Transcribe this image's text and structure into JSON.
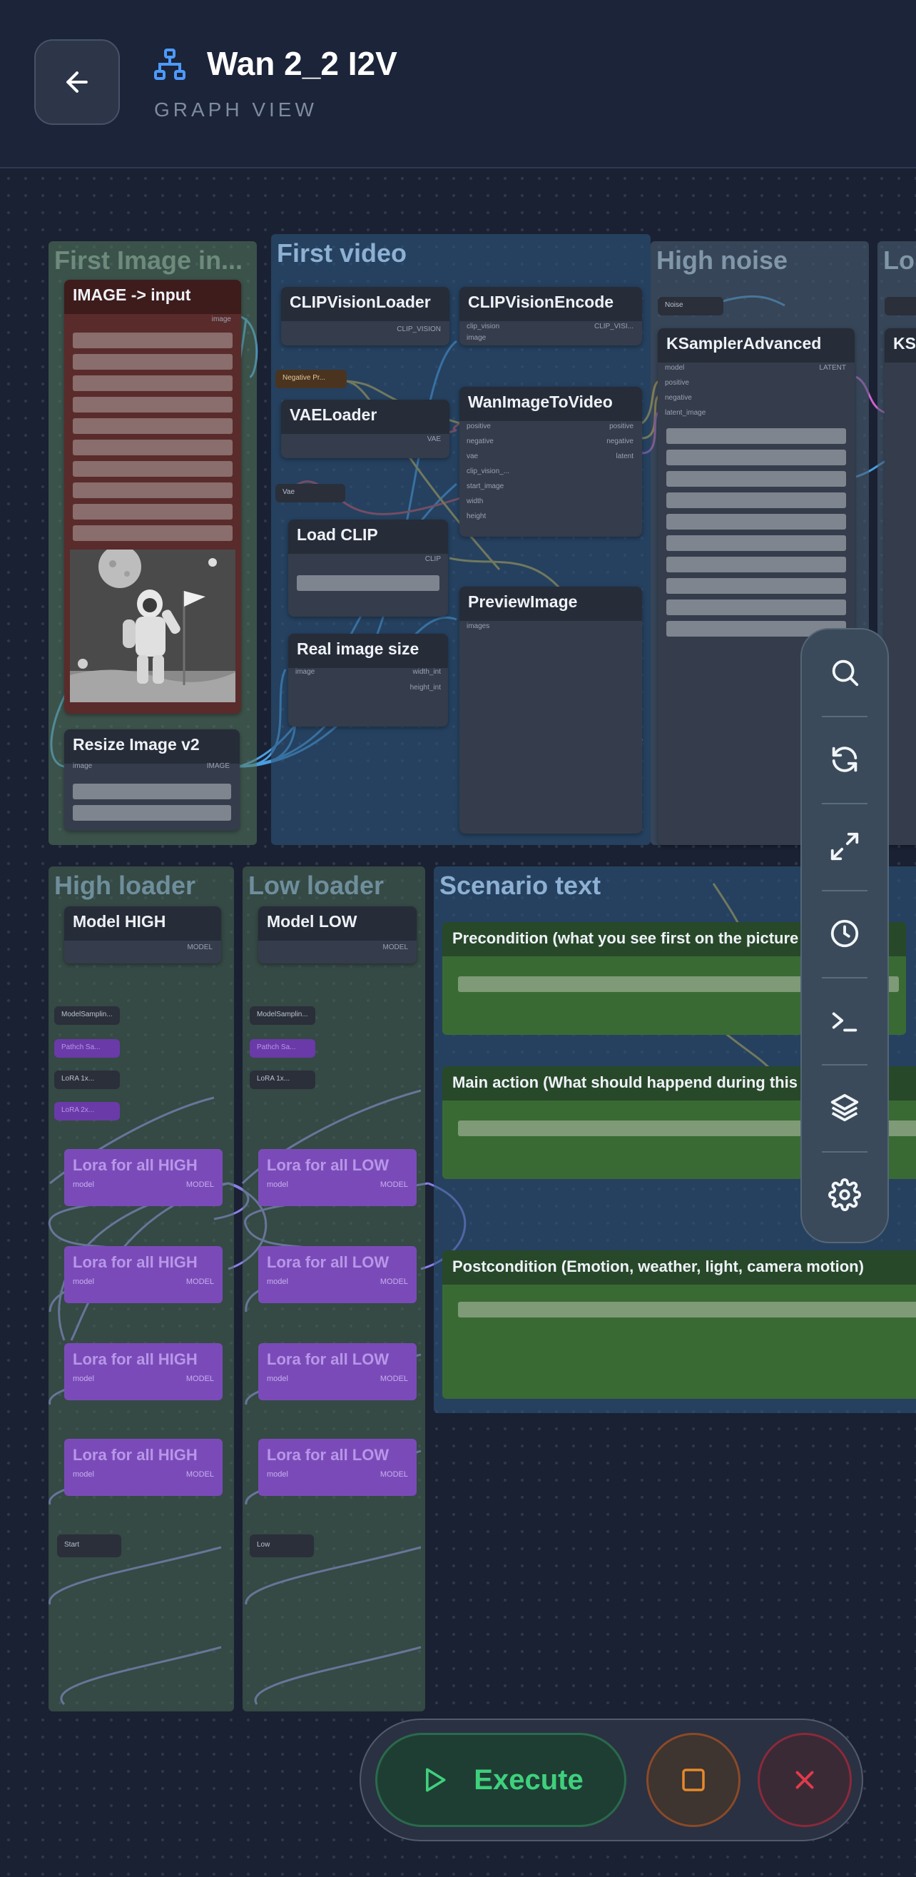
{
  "header": {
    "title": "Wan 2_2 I2V",
    "subtitle": "GRAPH VIEW",
    "back_icon": "arrow-left-icon",
    "title_icon": "graph-hierarchy-icon"
  },
  "graph": {
    "groups": {
      "first_image": "First Image in...",
      "first_video": "First video",
      "high_noise": "High noise",
      "low": "Lo",
      "high_loader": "High loader",
      "low_loader": "Low loader",
      "scenario_text": "Scenario text"
    },
    "nodes": {
      "image_input": {
        "title": "IMAGE -> input",
        "out": "image"
      },
      "resize_image": {
        "title": "Resize Image v2",
        "in": "image",
        "out": "IMAGE"
      },
      "clip_vision_loader": {
        "title": "CLIPVisionLoader",
        "out": "CLIP_VISION"
      },
      "clip_vision_encode": {
        "title": "CLIPVisionEncode",
        "in1": "clip_vision",
        "in2": "image",
        "out": "CLIP_VISI..."
      },
      "vae_loader": {
        "title": "VAELoader",
        "out": "VAE"
      },
      "wan_image_to_video": {
        "title": "WanImageToVideo",
        "inputs": [
          "positive",
          "negative",
          "vae",
          "clip_vision_...",
          "start_image",
          "width",
          "height"
        ],
        "outputs": [
          "positive",
          "negative",
          "latent"
        ]
      },
      "load_clip": {
        "title": "Load CLIP",
        "out": "CLIP"
      },
      "real_image_size": {
        "title": "Real image size",
        "in": "image",
        "out1": "width_int",
        "out2": "height_int"
      },
      "preview_image": {
        "title": "PreviewImage",
        "in": "images"
      },
      "ksampler_advanced": {
        "title": "KSamplerAdvanced",
        "inputs": [
          "model",
          "positive",
          "negative",
          "latent_image"
        ],
        "out": "LATENT"
      },
      "ksampler_partial": {
        "title": "KS"
      },
      "model_high": {
        "title": "Model HIGH",
        "out": "MODEL"
      },
      "model_low": {
        "title": "Model LOW",
        "out": "MODEL"
      },
      "negative_prompt": {
        "title": "Negative Pr..."
      },
      "vae_reroute": {
        "title": "Vae"
      },
      "noise_reroute": {
        "title": "Noise"
      },
      "start_high": {
        "title": "Start"
      },
      "start_low": {
        "title": "Low"
      },
      "high_small": [
        "ModelSamplin...",
        "Pathch Sa...",
        "LoRA 1x...",
        "LoRA 2x..."
      ],
      "low_small": [
        "ModelSamplin...",
        "Pathch Sa...",
        "LoRA 1x...",
        "LoRA 2x..."
      ],
      "lora_high": "Lora for all HIGH",
      "lora_low": "Lora for all LOW",
      "lora_in": "model",
      "lora_out": "MODEL"
    },
    "text_nodes": {
      "precondition": "Precondition (what you see first on the picture",
      "main_action": "Main action (What should happend during this",
      "postcondition": "Postcondition (Emotion, weather, light, camera motion)"
    }
  },
  "toolbar": {
    "tools": [
      "search-icon",
      "refresh-icon",
      "fit-view-icon",
      "history-icon",
      "terminal-icon",
      "layers-icon",
      "settings-icon"
    ]
  },
  "actions": {
    "execute_label": "Execute",
    "execute_icon": "play-icon",
    "stop_icon": "stop-icon",
    "cancel_icon": "close-icon"
  },
  "colors": {
    "execute": "#3fd07c",
    "stop": "#e58a2a",
    "cancel": "#e23a4a",
    "lora": "#7a4bb8",
    "group_blue": "#2d557a",
    "group_green": "#4d6b55"
  }
}
